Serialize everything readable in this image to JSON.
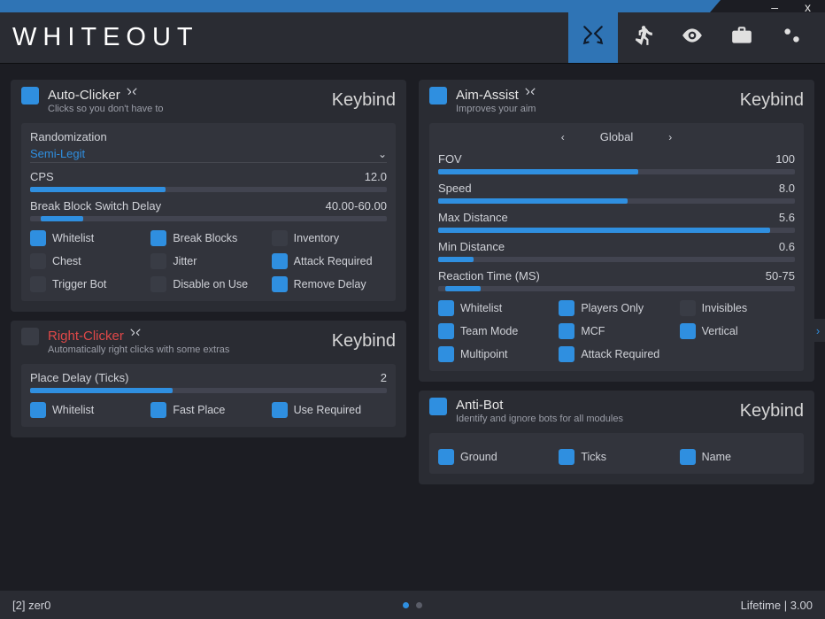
{
  "brand": "WHITEOUT",
  "accent": "#2f8fe0",
  "window_buttons": {
    "minimize": "–",
    "close": "x"
  },
  "header_tabs": [
    {
      "name": "combat",
      "active": true
    },
    {
      "name": "movement",
      "active": false
    },
    {
      "name": "visuals",
      "active": false
    },
    {
      "name": "utility",
      "active": false
    },
    {
      "name": "settings",
      "active": false
    }
  ],
  "footer": {
    "left": "[2] zer0",
    "right": "Lifetime | 3.00",
    "page_dots": 2,
    "page_active": 0
  },
  "modules": {
    "auto_clicker": {
      "title": "Auto-Clicker",
      "subtitle": "Clicks so you don't have to",
      "keybind_label": "Keybind",
      "enabled": true,
      "fields": {
        "randomization": {
          "label": "Randomization",
          "value": "Semi-Legit"
        },
        "cps": {
          "label": "CPS",
          "value": "12.0",
          "fill_pct": 38
        },
        "break_block_switch_delay": {
          "label": "Break Block Switch Delay",
          "value": "40.00-60.00",
          "range_left_pct": 3,
          "range_width_pct": 12
        }
      },
      "checks": [
        {
          "label": "Whitelist",
          "on": true
        },
        {
          "label": "Break Blocks",
          "on": true
        },
        {
          "label": "Inventory",
          "on": false
        },
        {
          "label": "Chest",
          "on": false
        },
        {
          "label": "Jitter",
          "on": false
        },
        {
          "label": "Attack Required",
          "on": true
        },
        {
          "label": "Trigger Bot",
          "on": false
        },
        {
          "label": "Disable on Use",
          "on": false
        },
        {
          "label": "Remove Delay",
          "on": true
        }
      ]
    },
    "right_clicker": {
      "title": "Right-Clicker",
      "subtitle": "Automatically right clicks with some extras",
      "keybind_label": "Keybind",
      "enabled": false,
      "title_alt": true,
      "fields": {
        "place_delay": {
          "label": "Place Delay (Ticks)",
          "value": "2",
          "fill_pct": 40
        }
      },
      "checks": [
        {
          "label": "Whitelist",
          "on": true
        },
        {
          "label": "Fast Place",
          "on": true
        },
        {
          "label": "Use Required",
          "on": true
        }
      ]
    },
    "aim_assist": {
      "title": "Aim-Assist",
      "subtitle": "Improves your aim",
      "keybind_label": "Keybind",
      "enabled": true,
      "paginator": {
        "label": "Global"
      },
      "fields": {
        "fov": {
          "label": "FOV",
          "value": "100",
          "fill_pct": 56
        },
        "speed": {
          "label": "Speed",
          "value": "8.0",
          "fill_pct": 53
        },
        "max_distance": {
          "label": "Max Distance",
          "value": "5.6",
          "fill_pct": 93
        },
        "min_distance": {
          "label": "Min Distance",
          "value": "0.6",
          "fill_pct": 10
        },
        "reaction_time": {
          "label": "Reaction Time (MS)",
          "value": "50-75",
          "range_left_pct": 2,
          "range_width_pct": 10
        }
      },
      "checks": [
        {
          "label": "Whitelist",
          "on": true
        },
        {
          "label": "Players Only",
          "on": true
        },
        {
          "label": "Invisibles",
          "on": false
        },
        {
          "label": "Team Mode",
          "on": true
        },
        {
          "label": "MCF",
          "on": true
        },
        {
          "label": "Vertical",
          "on": true
        },
        {
          "label": "Multipoint",
          "on": true
        },
        {
          "label": "Attack Required",
          "on": true
        }
      ]
    },
    "anti_bot": {
      "title": "Anti-Bot",
      "subtitle": "Identify and ignore bots for all modules",
      "keybind_label": "Keybind",
      "enabled": true,
      "checks": [
        {
          "label": "Ground",
          "on": true
        },
        {
          "label": "Ticks",
          "on": true
        },
        {
          "label": "Name",
          "on": true
        }
      ]
    }
  }
}
